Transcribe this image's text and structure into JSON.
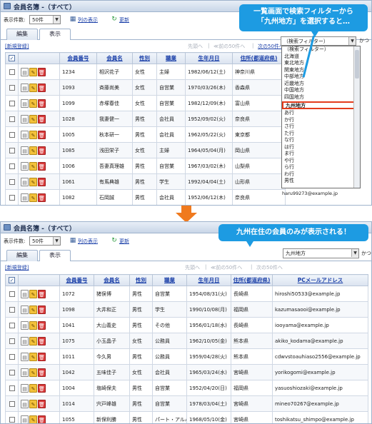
{
  "top": {
    "window_title": "会員名簿 -（すべて）",
    "show_count_label": "表示件数:",
    "show_count_value": "50件",
    "columns_link": "列の表示",
    "refresh_link": "更新",
    "tabs": [
      "編集",
      "表示"
    ],
    "new_link": "[新規登録]",
    "pager_prev": "先頭へ",
    "pager_prev50": "≪前の50件へ",
    "pager_next50": "次の50件へ",
    "filter_value": "（検索フィルター）",
    "filter_suffix": "かつ",
    "callout_line1": "一覧画面で検索フィルターから",
    "callout_line2": "「九州地方」を選択すると…",
    "headers": [
      "会員番号",
      "会員名",
      "性別",
      "職業",
      "生年月日",
      "住所(都道府県)"
    ],
    "rows": [
      {
        "id": "1234",
        "name": "相沢花子",
        "gender": "女性",
        "job": "主婦",
        "birth": "1982/06/12(土)",
        "pref": "神奈川県"
      },
      {
        "id": "1093",
        "name": "斉藤尚美",
        "gender": "女性",
        "job": "自営業",
        "birth": "1970/03/26(木)",
        "pref": "香森県"
      },
      {
        "id": "1099",
        "name": "赤塚春佳",
        "gender": "女性",
        "job": "自営業",
        "birth": "1982/12/09(木)",
        "pref": "富山県"
      },
      {
        "id": "1028",
        "name": "我妻健一",
        "gender": "男性",
        "job": "会社員",
        "birth": "1952/09/02(火)",
        "pref": "奈良県"
      },
      {
        "id": "1005",
        "name": "秋本研一",
        "gender": "男性",
        "job": "会社員",
        "birth": "1962/05/22(火)",
        "pref": "東京都"
      },
      {
        "id": "1085",
        "name": "浅田栄子",
        "gender": "女性",
        "job": "主婦",
        "birth": "1964/05/04(月)",
        "pref": "岡山県"
      },
      {
        "id": "1006",
        "name": "吾妻真理雄",
        "gender": "男性",
        "job": "自営業",
        "birth": "1967/03/02(木)",
        "pref": "山梨県"
      },
      {
        "id": "1061",
        "name": "有馬典雄",
        "gender": "男性",
        "job": "学生",
        "birth": "1992/04/04(土)",
        "pref": "山形県"
      },
      {
        "id": "1082",
        "name": "石岡誠",
        "gender": "男性",
        "job": "会社員",
        "birth": "1952/06/12(木)",
        "pref": "奈良県"
      }
    ],
    "dropdown_items": [
      "（検索フィルター）",
      "北海道",
      "東北地方",
      "関東地方",
      "中部地方",
      "近畿地方",
      "中国地方",
      "四国地方",
      "九州地方",
      "あ行",
      "か行",
      "さ行",
      "た行",
      "な行",
      "は行",
      "ま行",
      "や行",
      "ら行",
      "わ行",
      "男性"
    ],
    "peek_email": "haru99273@example.jp"
  },
  "bottom": {
    "window_title": "会員名簿 -（すべて）",
    "show_count_label": "表示件数:",
    "show_count_value": "50件",
    "columns_link": "列の表示",
    "refresh_link": "更新",
    "tabs": [
      "編集",
      "表示"
    ],
    "new_link": "[新規登録]",
    "pager_prev": "先頭へ",
    "pager_prev50": "≪前の50件へ",
    "pager_next50": "次の50件へ",
    "filter_value": "九州地方",
    "filter_suffix": "かつ",
    "callout_text": "九州在住の会員のみが表示される！",
    "headers": [
      "会員番号",
      "会員名",
      "性別",
      "職業",
      "生年月日",
      "住所(都道府県)",
      "PCメールアドレス"
    ],
    "rows": [
      {
        "id": "1072",
        "name": "猪俣博",
        "gender": "男性",
        "job": "自営業",
        "birth": "1954/08/31(火)",
        "pref": "長崎県",
        "email": "hiroshi50533@example.jp"
      },
      {
        "id": "1098",
        "name": "大井和正",
        "gender": "男性",
        "job": "学生",
        "birth": "1990/10/08(月)",
        "pref": "福岡県",
        "email": "kazumasaooi@example.jp"
      },
      {
        "id": "1041",
        "name": "大山義史",
        "gender": "男性",
        "job": "その他",
        "birth": "1956/01/18(水)",
        "pref": "長崎県",
        "email": "iooyama@example.jp"
      },
      {
        "id": "1075",
        "name": "小玉晶子",
        "gender": "女性",
        "job": "公務員",
        "birth": "1962/10/05(金)",
        "pref": "熊本県",
        "email": "akiko_kodama@example.jp"
      },
      {
        "id": "1011",
        "name": "今久男",
        "gender": "男性",
        "job": "公務員",
        "birth": "1959/04/28(火)",
        "pref": "熊本県",
        "email": "cdwvstoauhiaso2556@example.jp"
      },
      {
        "id": "1042",
        "name": "五味佳子",
        "gender": "女性",
        "job": "会社員",
        "birth": "1965/03/24(水)",
        "pref": "宮崎県",
        "email": "yorikogomi@example.jp"
      },
      {
        "id": "1004",
        "name": "塩崎保夫",
        "gender": "男性",
        "job": "自営業",
        "birth": "1952/04/20(日)",
        "pref": "福岡県",
        "email": "yasuoshiozaki@example.jp"
      },
      {
        "id": "1014",
        "name": "宍戸峰雄",
        "gender": "男性",
        "job": "自営業",
        "birth": "1978/03/04(土)",
        "pref": "宮崎県",
        "email": "mineo70267@example.jp"
      },
      {
        "id": "1055",
        "name": "新保利勝",
        "gender": "男性",
        "job": "パート・アルバイト",
        "birth": "1968/05/10(金)",
        "pref": "宮崎県",
        "email": "toshikatsu_shimpo@example.jp"
      }
    ]
  },
  "colors": {
    "callout": "#1d9be2",
    "arrow": "#f07a1e",
    "highlight": "#e43c1c",
    "link": "#1a3fa8"
  }
}
